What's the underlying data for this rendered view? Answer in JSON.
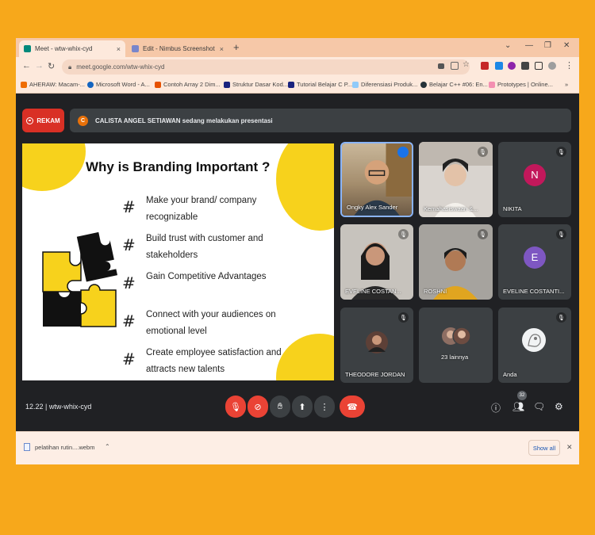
{
  "browser": {
    "tabs": [
      {
        "label": "Meet - wtw-whix-cyd",
        "close": "×"
      },
      {
        "label": "Edit - Nimbus Screenshot",
        "close": "×"
      }
    ],
    "new_tab": "+",
    "window_controls": [
      "⌄",
      "—",
      "❐",
      "✕"
    ],
    "url": "meet.google.com/wtw-whix-cyd",
    "bookmarks": [
      "AHERAW: Macam-...",
      "Microsoft Word - A...",
      "Contoh Array 2 Dim...",
      "Struktur Dasar Kod...",
      "Tutorial Belajar C P...",
      "Diferensiasi Produk...",
      "Belajar C++ #06: En...",
      "Prototypes | Online..."
    ]
  },
  "meet": {
    "record_label": "REKAM",
    "presenter_initial": "C",
    "presenting_text": "CALISTA ANGEL SETIAWAN sedang melakukan presentasi",
    "slide": {
      "title": "Why is Branding Important ?",
      "bullets": [
        "Make your brand/ company recognizable",
        "Build trust with customer and stakeholders",
        "Gain Competitive Advantages",
        "Connect with your audiences on emotional level",
        "Create employee satisfaction and attracts new talents"
      ]
    },
    "participants": [
      {
        "name": "Ongky Alex Sander"
      },
      {
        "name": "Kemahasiswaan &..."
      },
      {
        "name": "NIKITA",
        "initial": "N"
      },
      {
        "name": "EVELINE COSTAN..."
      },
      {
        "name": "ROSHNI"
      },
      {
        "name": "EVELINE COSTANTI...",
        "initial": "E"
      },
      {
        "name": "THEODORE JORDAN"
      },
      {
        "name": "23 lainnya"
      },
      {
        "name": "Anda"
      }
    ],
    "time": "12.22",
    "meeting_code": "wtw-whix-cyd",
    "participant_count": "32"
  },
  "download": {
    "file": "pelatihan rutin....webm",
    "show_all": "Show all"
  },
  "colors": {
    "page_bg": "#f7a81b",
    "meet_bg": "#202124",
    "tile_bg": "#3c4043",
    "red": "#ea4335",
    "slide_accent": "#f7d21c"
  }
}
